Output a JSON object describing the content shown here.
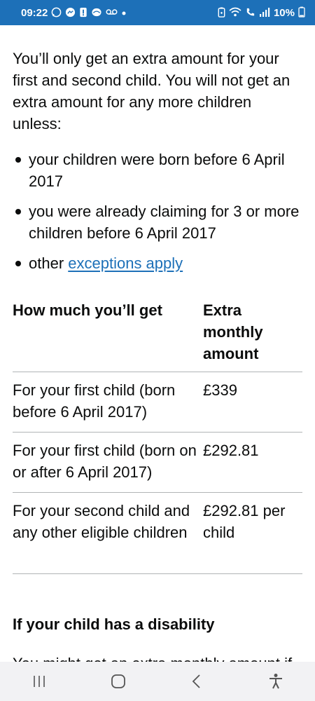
{
  "status_bar": {
    "time": "09:22",
    "battery": "10%",
    "notification_icons": [
      "whatsapp-icon",
      "messenger-icon",
      "alert-icon",
      "chat-icon",
      "voicemail-icon",
      "dot-icon"
    ],
    "system_icons": [
      "battery-saver-icon",
      "wifi-icon",
      "call-icon",
      "signal-icon",
      "battery-icon"
    ],
    "background_color": "#1d70b8"
  },
  "page": {
    "cut_top_text": "",
    "intro_paragraph": "You’ll only get an extra amount for your first and second child. You will not get an extra amount for any more children unless:",
    "bullets": [
      {
        "text": "your children were born before 6 April 2017"
      },
      {
        "text": "you were already claiming for 3 or more children before 6 April 2017"
      },
      {
        "prefix": "other ",
        "link": "exceptions apply"
      }
    ],
    "table": {
      "headers": [
        "How much you’ll get",
        "Extra monthly amount"
      ],
      "rows": [
        [
          "For your first child (born before 6 April 2017)",
          "£339"
        ],
        [
          "For your first child (born on or after 6 April 2017)",
          "£292.81"
        ],
        [
          "For your second child and any other eligible children",
          "£292.81 per child"
        ]
      ]
    },
    "subheading": "If your child has a disability",
    "cut_bottom_text": "You might get an extra monthly amount if",
    "link_color": "#1d70b8"
  },
  "nav_bar": {
    "buttons": [
      "recent-apps-icon",
      "home-icon",
      "back-icon",
      "accessibility-icon"
    ]
  }
}
